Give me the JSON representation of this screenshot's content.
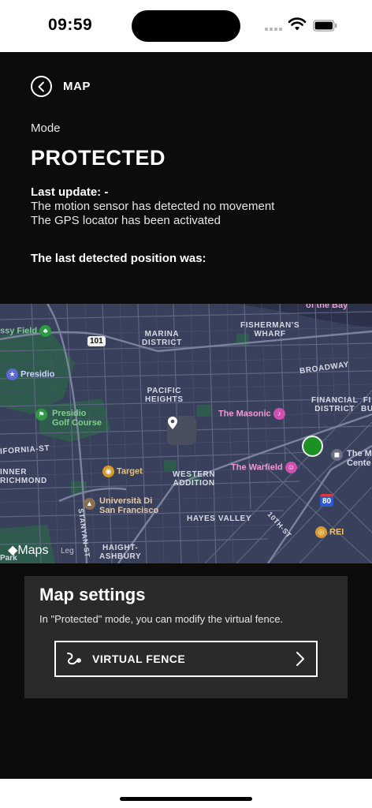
{
  "status_bar": {
    "time": "09:59"
  },
  "nav": {
    "title": "MAP",
    "back_icon": "chevron-left-circle-icon"
  },
  "mode": {
    "label": "Mode",
    "value": "PROTECTED"
  },
  "update": {
    "label": "Last update: -",
    "line1": "The motion sensor has detected no movement",
    "line2": "The GPS locator has been activated"
  },
  "last_position_label": "The last detected position was:",
  "map": {
    "attribution": "Maps",
    "legal": "Leg",
    "labels": {
      "marina": "MARINA\nDISTRICT",
      "pacific": "PACIFIC\nHEIGHTS",
      "western": "WESTERN\nADDITION",
      "hayes": "HAYES VALLEY",
      "haight": "HAIGHT-\nASHBURY",
      "inner_richmond": "INNER\nRICHMOND",
      "fishermans": "FISHERMAN'S\nWHARF",
      "financial": "FINANCIAL\nDISTRICT",
      "broadway": "BROADWAY",
      "california": "IFORNIA-ST",
      "stanyan": "STANYAN-ST",
      "tenth": "10TH-ST",
      "fin_partial": "FI\nBU",
      "park": "Park"
    },
    "pois": {
      "crissy": "ssy Field",
      "presidio": "Presidio",
      "presidio_golf": "Presidio\nGolf Course",
      "masonic": "The Masonic",
      "warfield": "The Warfield",
      "target": "Target",
      "universita": "Università Di\nSan Francisco",
      "rei": "REI",
      "bay": "of the Bay",
      "center": "The M\nCente"
    },
    "shields": {
      "us101": "101",
      "i80": "80"
    },
    "colors": {
      "background": "#39405b",
      "street": "#5d6580",
      "park": "#2f5b4f",
      "dot": "#1c8f25"
    }
  },
  "settings": {
    "title": "Map settings",
    "description": "In \"Protected\" mode, you can modify the virtual fence.",
    "button_label": "VIRTUAL FENCE",
    "button_icon": "route-icon",
    "chevron_icon": "chevron-right-icon"
  }
}
